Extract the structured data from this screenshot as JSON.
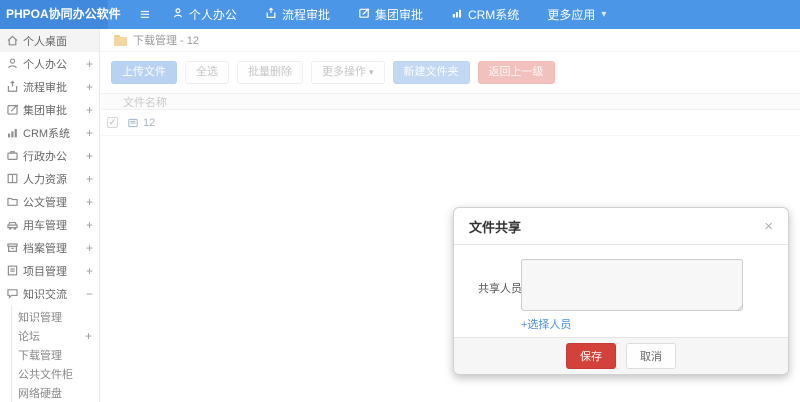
{
  "navbar": {
    "logo": "PHPOA协同办公软件",
    "hamburger": "≡",
    "items": [
      {
        "label": "个人办公",
        "icon": "user-icon"
      },
      {
        "label": "流程审批",
        "icon": "flow-icon"
      },
      {
        "label": "集团审批",
        "icon": "edit-icon"
      },
      {
        "label": "CRM系统",
        "icon": "chart-icon"
      },
      {
        "label": "更多应用",
        "icon": "caret-down-icon",
        "caret": "▾"
      }
    ]
  },
  "sidebar": {
    "items": [
      {
        "label": "个人桌面",
        "icon": "home-icon",
        "expander": ""
      },
      {
        "label": "个人办公",
        "icon": "user-icon",
        "expander": "+"
      },
      {
        "label": "流程审批",
        "icon": "flow-icon",
        "expander": "+"
      },
      {
        "label": "集团审批",
        "icon": "edit-icon",
        "expander": "+"
      },
      {
        "label": "CRM系统",
        "icon": "chart-icon",
        "expander": "+"
      },
      {
        "label": "行政办公",
        "icon": "briefcase-icon",
        "expander": "+"
      },
      {
        "label": "人力资源",
        "icon": "book-icon",
        "expander": "+"
      },
      {
        "label": "公文管理",
        "icon": "folder-icon",
        "expander": "+"
      },
      {
        "label": "用车管理",
        "icon": "car-icon",
        "expander": "+"
      },
      {
        "label": "档案管理",
        "icon": "archive-icon",
        "expander": "+"
      },
      {
        "label": "项目管理",
        "icon": "project-icon",
        "expander": "+"
      },
      {
        "label": "知识交流",
        "icon": "chat-icon",
        "expander": "−"
      }
    ],
    "subitems": [
      {
        "label": "知识管理",
        "expander": ""
      },
      {
        "label": "论坛",
        "expander": "+"
      },
      {
        "label": "下载管理",
        "expander": ""
      },
      {
        "label": "公共文件柜",
        "expander": ""
      },
      {
        "label": "网络硬盘",
        "expander": ""
      }
    ]
  },
  "breadcrumb": {
    "text": "下载管理 - 12"
  },
  "toolbar": {
    "upload": "上传文件",
    "select_all": "全选",
    "batch_delete": "批量删除",
    "more_actions": "更多操作",
    "more_caret": "▾",
    "new_folder": "新建文件夹",
    "go_back": "返回上一级"
  },
  "table": {
    "header": "文件名称",
    "row_check": "✓",
    "rows": [
      {
        "name": "12"
      }
    ]
  },
  "modal": {
    "title": "文件共享",
    "close": "×",
    "label": "共享人员",
    "textarea_value": "",
    "select_link": "+选择人员",
    "save": "保存",
    "cancel": "取消"
  },
  "colors": {
    "navbar": "#4c96e8",
    "logo_bg": "#4189dd",
    "primary_button": "#b9d2f1",
    "danger_button": "#f2c1be",
    "save_button": "#d2413a",
    "link": "#4a90e2"
  }
}
